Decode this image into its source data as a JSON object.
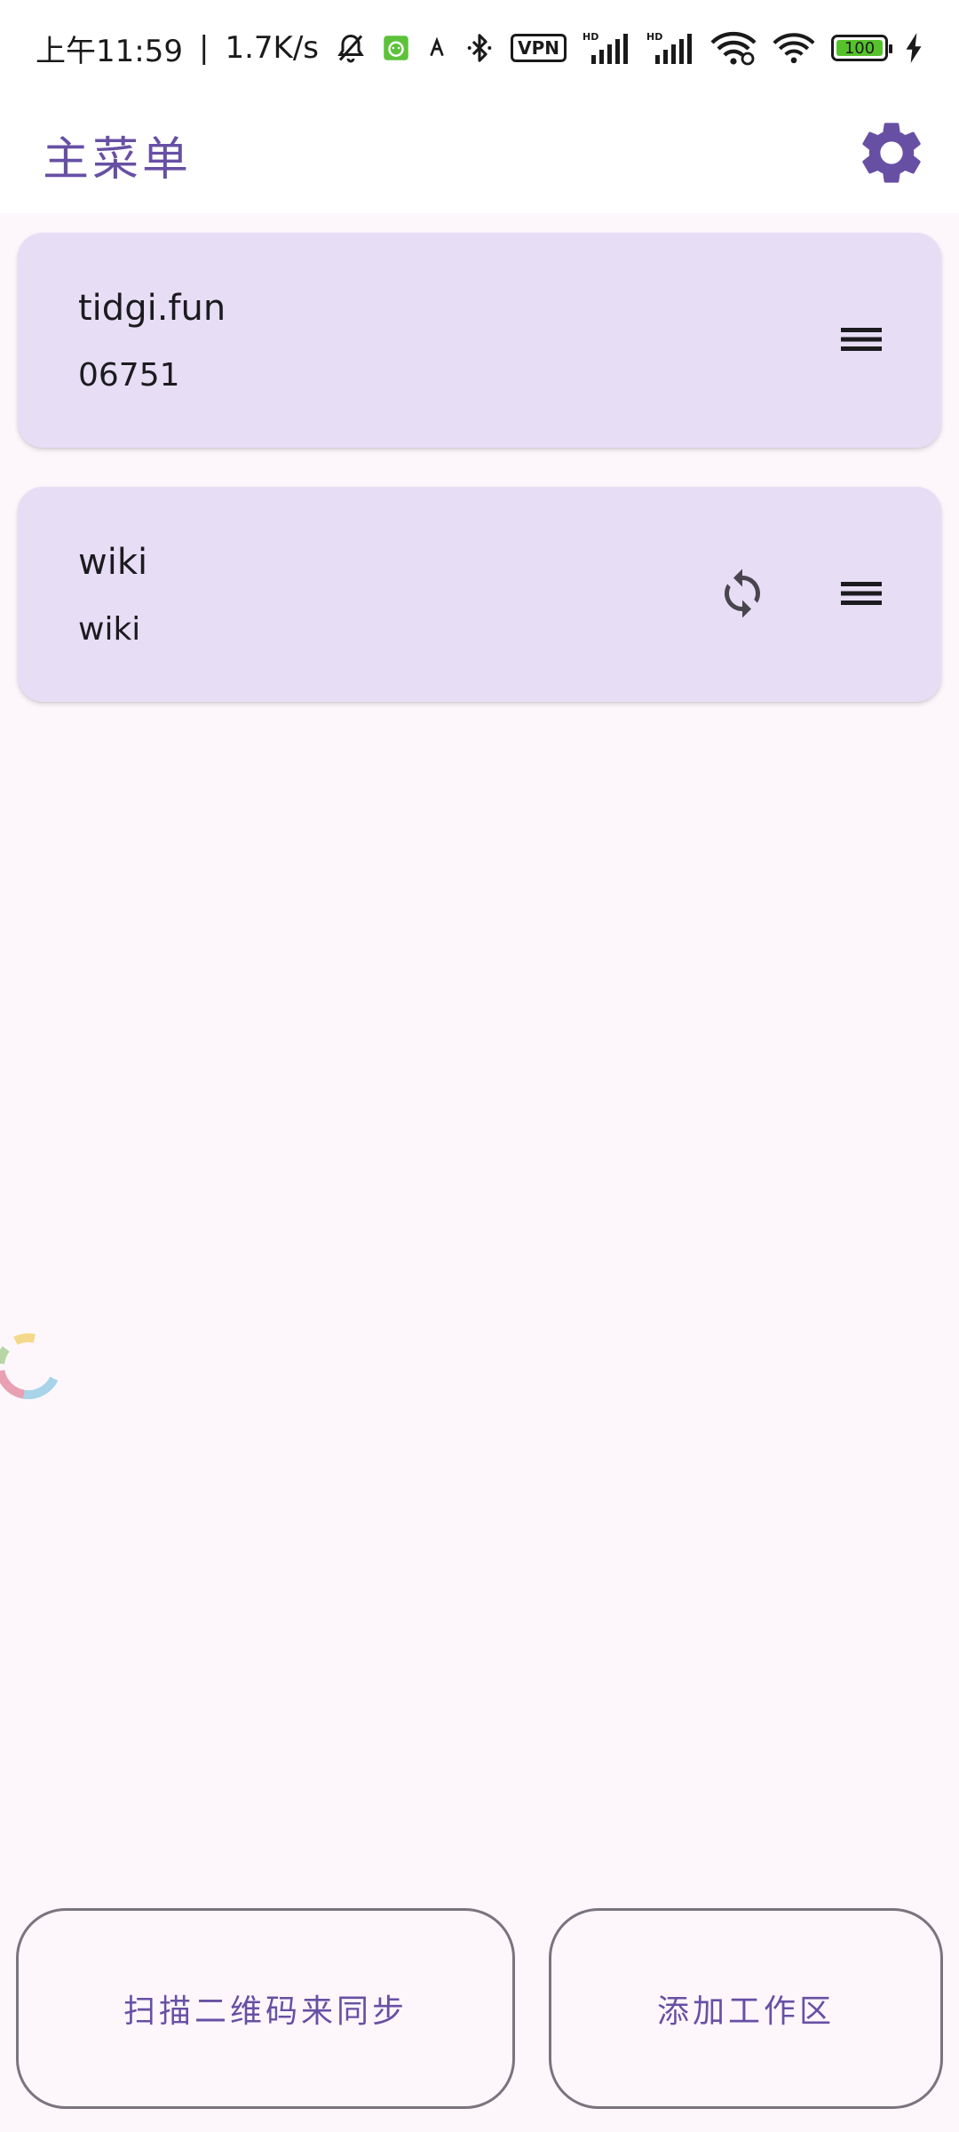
{
  "status_bar": {
    "time": "上午11:59",
    "separator": "|",
    "net_speed": "1.7K/s",
    "vpn_label": "VPN",
    "hd_label": "HD",
    "battery_level": "100",
    "battery_color": "#56c22b"
  },
  "app_bar": {
    "title": "主菜单",
    "settings_icon": "gear-icon",
    "accent_color": "#6750a4"
  },
  "workspaces": [
    {
      "name": "tidgi.fun",
      "subtitle": "06751",
      "has_sync": false
    },
    {
      "name": "wiki",
      "subtitle": "wiki",
      "has_sync": true
    }
  ],
  "bottom_actions": {
    "scan_label": "扫描二维码来同步",
    "add_label": "添加工作区"
  },
  "colors": {
    "background": "#fdf7fc",
    "card": "#e7def6",
    "outline": "#79747e"
  }
}
